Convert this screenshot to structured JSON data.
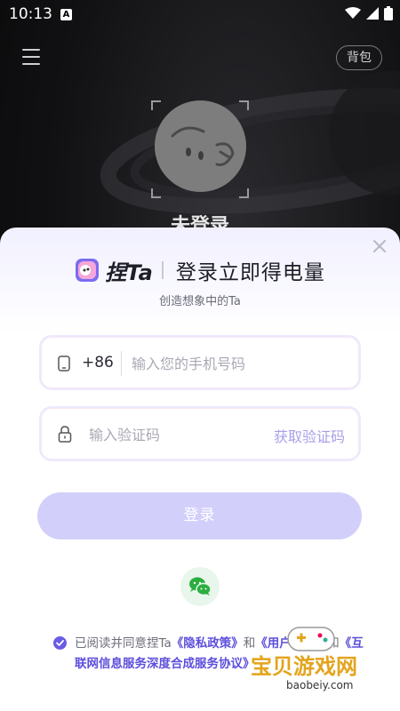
{
  "status_bar": {
    "time": "10:13",
    "notification_letter": "A"
  },
  "header": {
    "backpack_label": "背包"
  },
  "profile": {
    "status_text": "未登录"
  },
  "login_sheet": {
    "brand_name": "捏Ta",
    "headline": "登录立即得电量",
    "subtitle": "创造想象中的Ta",
    "phone_field": {
      "country_code": "+86",
      "placeholder": "输入您的手机号码"
    },
    "code_field": {
      "placeholder": "输入验证码",
      "get_code_label": "获取验证码"
    },
    "login_button": "登录",
    "agreement": {
      "prefix": "已阅读并同意捏Ta",
      "privacy_link": "《隐私政策》",
      "and1": "和",
      "user_link": "《用户协议》",
      "and2": "和",
      "deep_synthesis_link": "《互联网信息服务深度合成服务协议》"
    }
  },
  "watermark": {
    "text": "宝贝游戏网",
    "url": "baobeiy.com"
  },
  "colors": {
    "accent": "#5d4fdc",
    "button_disabled": "#d3cffb",
    "wechat_green": "#1aad19"
  }
}
